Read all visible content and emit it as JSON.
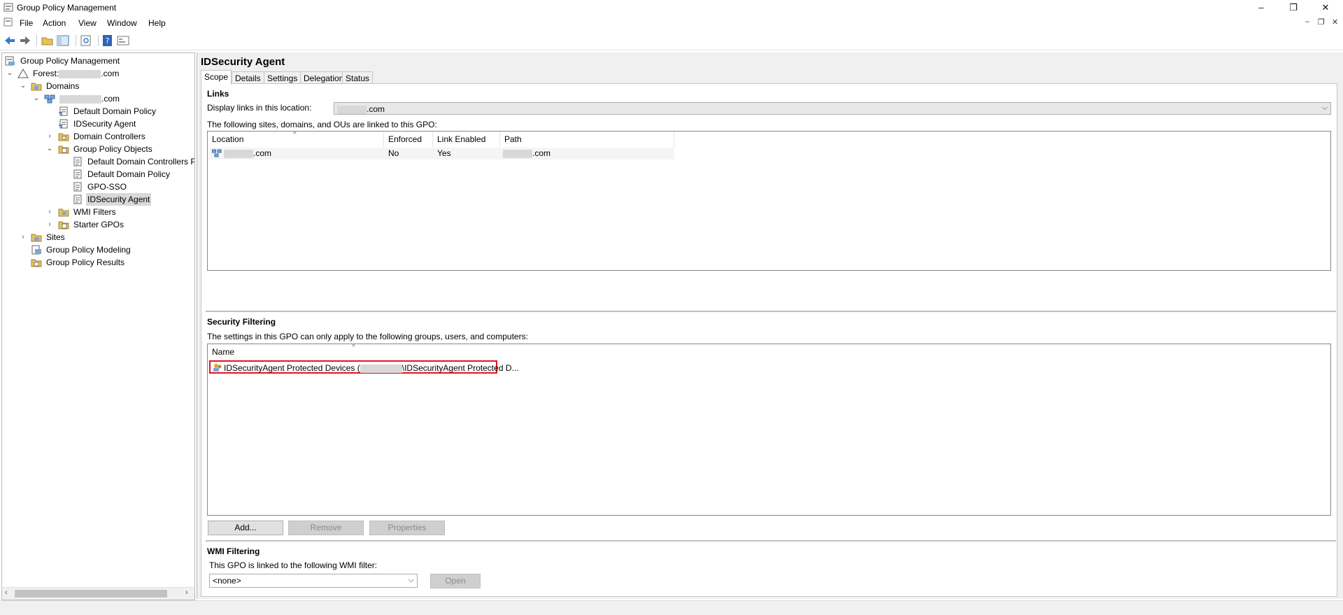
{
  "window": {
    "title": "Group Policy Management",
    "minimize": "–",
    "restore": "❐",
    "close": "✕"
  },
  "menu": {
    "items": [
      "File",
      "Action",
      "View",
      "Window",
      "Help"
    ],
    "mdi_min": "–",
    "mdi_restore": "❐",
    "mdi_close": "✕"
  },
  "tree": {
    "root": "Group Policy Management",
    "forest_prefix": "Forest:",
    "forest_suffix": ".com",
    "domains": "Domains",
    "domain_suffix": ".com",
    "default_domain_policy": "Default Domain Policy",
    "idsecurity_agent": "IDSecurity Agent",
    "domain_controllers": "Domain Controllers",
    "group_policy_objects": "Group Policy Objects",
    "gpo_items": [
      "Default Domain Controllers P",
      "Default Domain Policy",
      "GPO-SSO",
      "IDSecurity Agent"
    ],
    "wmi_filters": "WMI Filters",
    "starter_gpos": "Starter GPOs",
    "sites": "Sites",
    "modeling": "Group Policy Modeling",
    "results": "Group Policy Results"
  },
  "gpo": {
    "title": "IDSecurity Agent",
    "tabs": [
      "Scope",
      "Details",
      "Settings",
      "Delegation",
      "Status"
    ],
    "links": {
      "heading": "Links",
      "location_label": "Display links in this location:",
      "location_value_suffix": ".com",
      "linked_text": "The following sites, domains, and OUs are linked to this GPO:",
      "columns": [
        "Location",
        "Enforced",
        "Link Enabled",
        "Path"
      ],
      "rows": [
        {
          "location_suffix": ".com",
          "enforced": "No",
          "link_enabled": "Yes",
          "path_suffix": ".com"
        }
      ]
    },
    "security": {
      "heading": "Security Filtering",
      "description": "The settings in this GPO can only apply to the following groups, users, and computers:",
      "columns": [
        "Name"
      ],
      "entry_prefix": "IDSecurityAgent Protected Devices (",
      "entry_suffix": "\\IDSecurityAgent Protected D...",
      "buttons": {
        "add": "Add...",
        "remove": "Remove",
        "properties": "Properties"
      }
    },
    "wmi": {
      "heading": "WMI Filtering",
      "description": "This GPO is linked to the following WMI filter:",
      "filter_value": "<none>",
      "open_button": "Open"
    }
  },
  "colors": {
    "highlight_border": "#e81123",
    "selection": "#d9d9d9",
    "pane_bg": "#f0f0f0"
  }
}
